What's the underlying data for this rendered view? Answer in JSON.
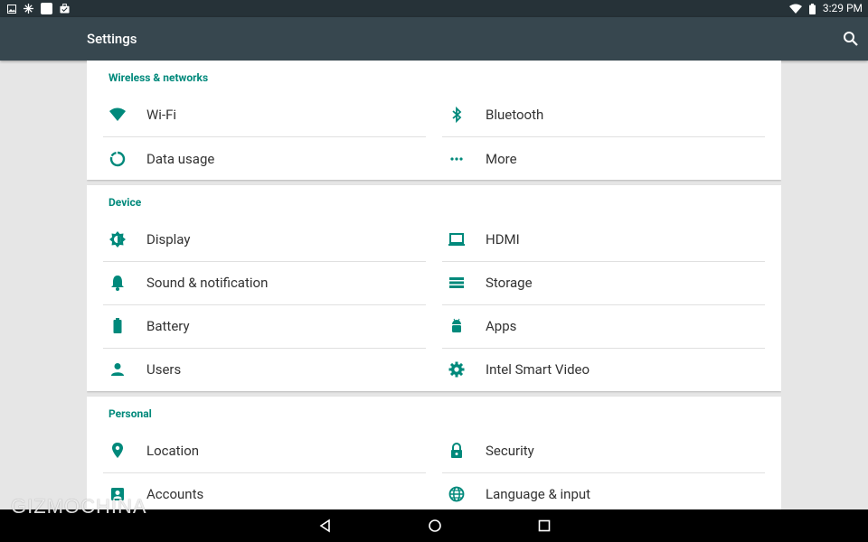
{
  "status_bar": {
    "time": "3:29 PM",
    "left_icons": [
      "image-icon",
      "snowflake-icon",
      "blank-square-icon",
      "briefcase-icon"
    ],
    "right_icons": [
      "wifi-icon",
      "battery-icon"
    ]
  },
  "app_bar": {
    "title": "Settings",
    "search_icon": "search-icon"
  },
  "accent_color": "#00897b",
  "sections": [
    {
      "title": "Wireless & networks",
      "items": [
        {
          "label": "Wi-Fi",
          "icon": "wifi-icon"
        },
        {
          "label": "Bluetooth",
          "icon": "bluetooth-icon"
        },
        {
          "label": "Data usage",
          "icon": "data-usage-icon"
        },
        {
          "label": "More",
          "icon": "more-icon"
        }
      ]
    },
    {
      "title": "Device",
      "items": [
        {
          "label": "Display",
          "icon": "brightness-icon"
        },
        {
          "label": "HDMI",
          "icon": "laptop-icon"
        },
        {
          "label": "Sound & notification",
          "icon": "bell-icon"
        },
        {
          "label": "Storage",
          "icon": "storage-icon"
        },
        {
          "label": "Battery",
          "icon": "battery-icon"
        },
        {
          "label": "Apps",
          "icon": "android-icon"
        },
        {
          "label": "Users",
          "icon": "person-icon"
        },
        {
          "label": "Intel Smart Video",
          "icon": "gear-icon"
        }
      ]
    },
    {
      "title": "Personal",
      "items": [
        {
          "label": "Location",
          "icon": "location-pin-icon"
        },
        {
          "label": "Security",
          "icon": "lock-icon"
        },
        {
          "label": "Accounts",
          "icon": "account-box-icon"
        },
        {
          "label": "Language & input",
          "icon": "globe-icon"
        }
      ]
    }
  ],
  "nav_bar": {
    "back": "back-icon",
    "home": "home-icon",
    "recents": "recents-icon"
  },
  "watermark": "GIZMOCHINA"
}
